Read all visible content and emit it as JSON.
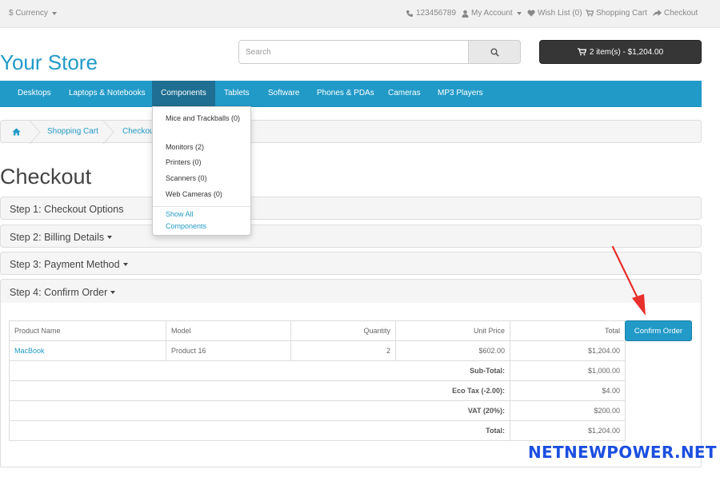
{
  "topbar": {
    "currency": "$ Currency",
    "phone": "123456789",
    "my_account": "My Account",
    "wish_list": "Wish List (0)",
    "shopping_cart": "Shopping Cart",
    "checkout": "Checkout"
  },
  "header": {
    "logo": "Your Store",
    "search_placeholder": "Search",
    "cart_label": "2 item(s) - $1,204.00"
  },
  "nav": {
    "items": [
      "Desktops",
      "Laptops & Notebooks",
      "Components",
      "Tablets",
      "Software",
      "Phones & PDAs",
      "Cameras",
      "MP3 Players"
    ],
    "active": "Components"
  },
  "dropdown": {
    "items": [
      "Mice and Trackballs (0)",
      "Monitors (2)",
      "Printers (0)",
      "Scanners (0)",
      "Web Cameras (0)"
    ],
    "show_all": "Show All Components"
  },
  "breadcrumb": {
    "items": [
      "Shopping Cart",
      "Checkout"
    ]
  },
  "page_title": "Checkout",
  "steps": [
    "Step 1: Checkout Options",
    "Step 2: Billing Details",
    "Step 3: Payment Method",
    "Step 4: Confirm Order"
  ],
  "order": {
    "headers": [
      "Product Name",
      "Model",
      "Quantity",
      "Unit Price",
      "Total"
    ],
    "rows": [
      {
        "name": "MacBook",
        "model": "Product 16",
        "quantity": "2",
        "unit_price": "$602.00",
        "total": "$1,204.00"
      }
    ],
    "totals": [
      {
        "label": "Sub-Total:",
        "value": "$1,000.00"
      },
      {
        "label": "Eco Tax (-2.00):",
        "value": "$4.00"
      },
      {
        "label": "VAT (20%):",
        "value": "$200.00"
      },
      {
        "label": "Total:",
        "value": "$1,204.00"
      }
    ],
    "confirm_button": "Confirm Order"
  },
  "watermark": "NETNEWPOWER.NET",
  "colors": {
    "accent": "#229ac8",
    "nav_active": "#1e6f92",
    "cart_button": "#363636",
    "arrow": "#e8302c",
    "watermark": "#1c4fe0"
  },
  "icons": {
    "phone": "phone-icon",
    "user": "user-icon",
    "heart": "heart-icon",
    "cart": "cart-icon",
    "share": "share-icon",
    "search": "search-icon",
    "home": "home-icon"
  }
}
